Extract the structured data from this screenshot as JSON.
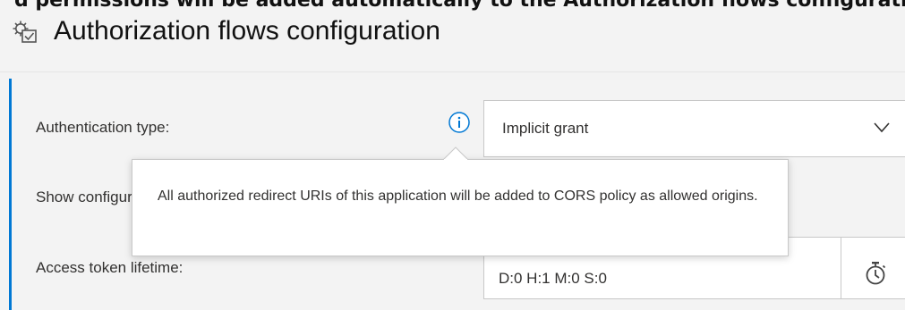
{
  "header": {
    "cutoff_text": "d permissions will be added automatically to the Authorization flows configuration",
    "title": "Authorization flows configuration"
  },
  "fields": {
    "authentication_type": {
      "label": "Authentication type:",
      "value": "Implicit grant"
    },
    "cors": {
      "label": "Show configuration of CORS"
    },
    "access_token_lifetime": {
      "label": "Access token lifetime:",
      "value": "D:0 H:1 M:0 S:0"
    }
  },
  "tooltip": {
    "text": "All authorized redirect URIs of this application will be added to CORS policy as allowed origins."
  },
  "icons": {
    "section": "gear-check-icon",
    "info": "info-icon",
    "chevron": "chevron-down-icon",
    "timer": "stopwatch-icon"
  },
  "colors": {
    "accent": "#0078d4",
    "background": "#f3f3f3",
    "border": "#c8c8c8"
  }
}
